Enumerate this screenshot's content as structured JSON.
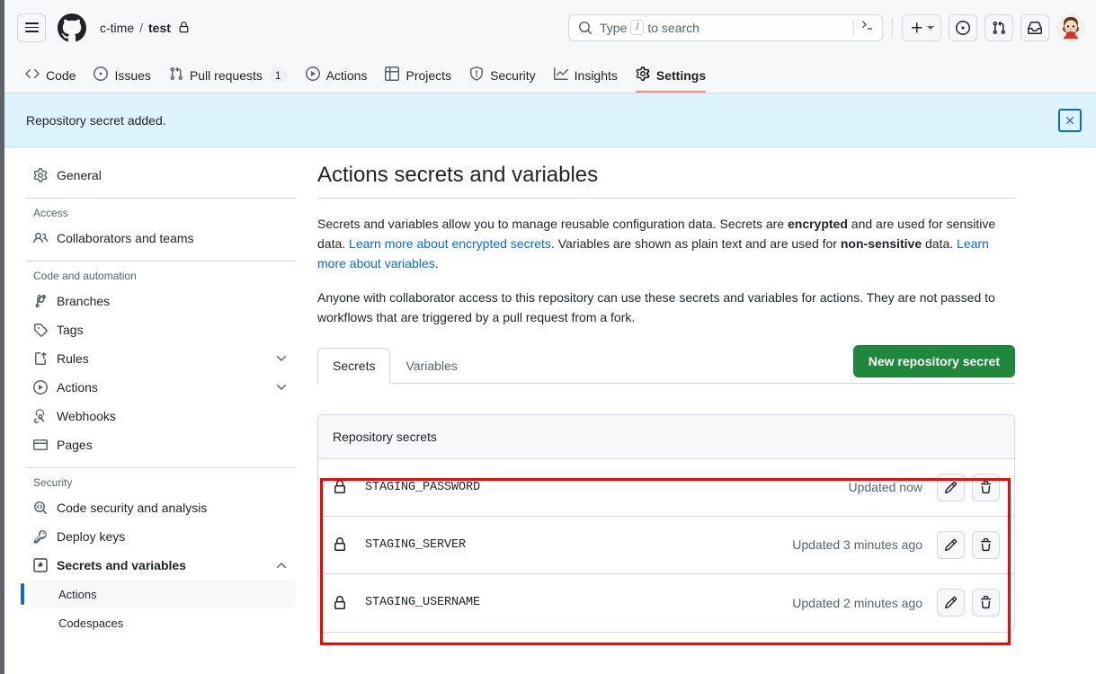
{
  "header": {
    "menu_icon": "hamburger-icon",
    "logo_icon": "github-mark-icon",
    "breadcrumb": {
      "owner": "c-time",
      "separator": "/",
      "repo": "test",
      "visibility_icon": "lock-icon"
    },
    "search": {
      "placeholder_prefix": "Type",
      "placeholder_key": "/",
      "placeholder_suffix": "to search",
      "search_icon": "search-icon",
      "command_palette_icon": "terminal-icon"
    },
    "actions": {
      "create_new_label": "+",
      "create_new_icon": "plus-icon",
      "issues_icon": "issue-opened-icon",
      "pull_requests_icon": "git-pull-request-icon",
      "inbox_icon": "inbox-icon",
      "avatar_icon": "user-avatar"
    }
  },
  "repo_nav": {
    "items": [
      {
        "label": "Code",
        "icon": "code-icon",
        "active": false,
        "count": null
      },
      {
        "label": "Issues",
        "icon": "issue-opened-icon",
        "active": false,
        "count": null
      },
      {
        "label": "Pull requests",
        "icon": "git-pull-request-icon",
        "active": false,
        "count": "1"
      },
      {
        "label": "Actions",
        "icon": "play-icon",
        "active": false,
        "count": null
      },
      {
        "label": "Projects",
        "icon": "table-icon",
        "active": false,
        "count": null
      },
      {
        "label": "Security",
        "icon": "shield-icon",
        "active": false,
        "count": null
      },
      {
        "label": "Insights",
        "icon": "graph-icon",
        "active": false,
        "count": null
      },
      {
        "label": "Settings",
        "icon": "gear-icon",
        "active": true,
        "count": null
      }
    ]
  },
  "flash": {
    "message": "Repository secret added.",
    "close_icon": "close-icon",
    "background_color": "#ddf4ff"
  },
  "sidebar": {
    "general": {
      "label": "General",
      "icon": "gear-icon"
    },
    "groups": [
      {
        "title": "Access",
        "items": [
          {
            "label": "Collaborators and teams",
            "icon": "people-icon",
            "expandable": false
          }
        ]
      },
      {
        "title": "Code and automation",
        "items": [
          {
            "label": "Branches",
            "icon": "git-branch-icon",
            "expandable": false
          },
          {
            "label": "Tags",
            "icon": "tag-icon",
            "expandable": false
          },
          {
            "label": "Rules",
            "icon": "rules-icon",
            "expandable": true,
            "expanded": false
          },
          {
            "label": "Actions",
            "icon": "play-icon",
            "expandable": true,
            "expanded": false
          },
          {
            "label": "Webhooks",
            "icon": "webhook-icon",
            "expandable": false
          },
          {
            "label": "Pages",
            "icon": "browser-icon",
            "expandable": false
          }
        ]
      },
      {
        "title": "Security",
        "items": [
          {
            "label": "Code security and analysis",
            "icon": "codescan-icon",
            "expandable": false
          },
          {
            "label": "Deploy keys",
            "icon": "key-icon",
            "expandable": false
          },
          {
            "label": "Secrets and variables",
            "icon": "asterisk-icon",
            "expandable": true,
            "expanded": true
          }
        ],
        "subitems": [
          {
            "label": "Actions",
            "active": true
          },
          {
            "label": "Codespaces",
            "active": false
          }
        ]
      }
    ]
  },
  "main": {
    "title": "Actions secrets and variables",
    "paragraph1": {
      "part1": "Secrets and variables allow you to manage reusable configuration data. Secrets are ",
      "bold1": "encrypted",
      "part2": " and are used for sensitive data. ",
      "link1": "Learn more about encrypted secrets",
      "part3": ". Variables are shown as plain text and are used for ",
      "bold2": "non-sensitive",
      "part4": " data. ",
      "link2": "Learn more about variables",
      "part5": "."
    },
    "paragraph2": "Anyone with collaborator access to this repository can use these secrets and variables for actions. They are not passed to workflows that are triggered by a pull request from a fork.",
    "tabs": [
      {
        "label": "Secrets",
        "active": true
      },
      {
        "label": "Variables",
        "active": false
      }
    ],
    "new_secret_button": "New repository secret",
    "new_secret_button_color": "#1f883d",
    "secrets_panel": {
      "header": "Repository secrets",
      "rows": [
        {
          "lock_icon": "lock-icon",
          "name": "STAGING_PASSWORD",
          "updated": "Updated now",
          "edit_icon": "pencil-icon",
          "delete_icon": "trash-icon"
        },
        {
          "lock_icon": "lock-icon",
          "name": "STAGING_SERVER",
          "updated": "Updated 3 minutes ago",
          "edit_icon": "pencil-icon",
          "delete_icon": "trash-icon"
        },
        {
          "lock_icon": "lock-icon",
          "name": "STAGING_USERNAME",
          "updated": "Updated 2 minutes ago",
          "edit_icon": "pencil-icon",
          "delete_icon": "trash-icon"
        }
      ]
    }
  },
  "annotation": {
    "highlight_color": "#ff0000"
  }
}
